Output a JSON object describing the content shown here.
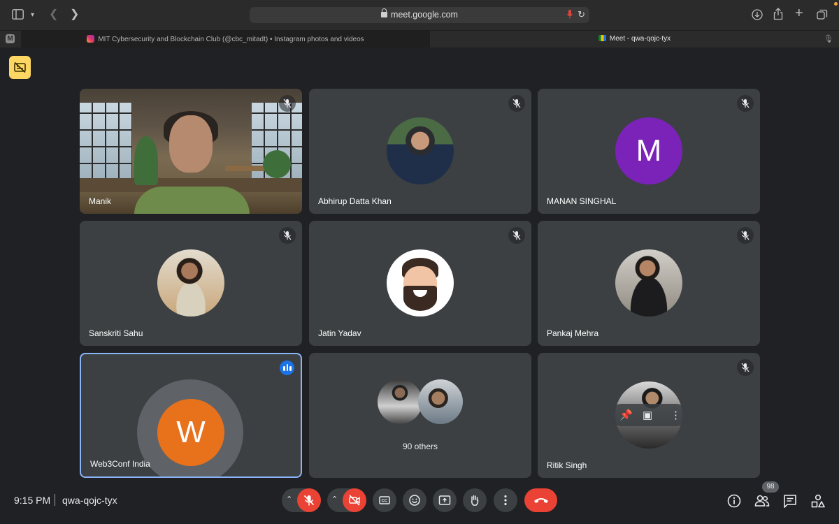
{
  "browser": {
    "url": "meet.google.com",
    "tabs": [
      {
        "label": "MIT Cybersecurity and Blockchain Club (@cbc_mitadt) • Instagram photos and videos"
      },
      {
        "label": "Meet - qwa-qojc-tyx"
      }
    ],
    "profile_initial": "M"
  },
  "meeting": {
    "time": "9:15 PM",
    "code": "qwa-qojc-tyx",
    "participants_count": "98"
  },
  "tiles": [
    {
      "name": "Manik",
      "type": "video",
      "muted": true
    },
    {
      "name": "Abhirup Datta Khan",
      "type": "photo",
      "muted": true
    },
    {
      "name": "MANAN SINGHAL",
      "type": "letter",
      "letter": "M",
      "color": "#7b22b9",
      "muted": true
    },
    {
      "name": "Sanskriti Sahu",
      "type": "photo",
      "muted": true
    },
    {
      "name": "Jatin Yadav",
      "type": "memoji",
      "muted": true
    },
    {
      "name": "Pankaj Mehra",
      "type": "photo",
      "muted": true
    },
    {
      "name": "Web3Conf India",
      "type": "letter",
      "letter": "W",
      "color": "#e8711c",
      "speaking": true
    },
    {
      "name": "90 others",
      "type": "group"
    },
    {
      "name": "Ritik Singh",
      "type": "photo",
      "muted": true
    }
  ],
  "controls": {
    "mic": "mic-off",
    "camera": "camera-off",
    "captions": "closed-captions",
    "reactions": "emoji",
    "present": "present-screen",
    "raise_hand": "raise-hand",
    "more": "more-options",
    "leave": "end-call"
  },
  "colors": {
    "background": "#202124",
    "tile": "#3c4043",
    "danger": "#ea4335",
    "speaking_border": "#8ab4f8",
    "caption_badge": "#fdd663"
  }
}
